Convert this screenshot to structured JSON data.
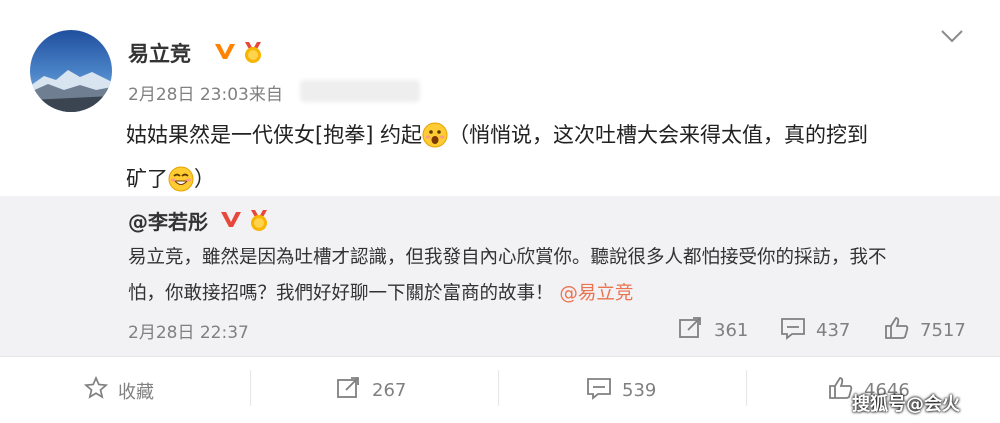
{
  "post": {
    "username": "易立竞",
    "time": "2月28日 23:03",
    "source_prefix": "来自",
    "content_part1": "姑姑果然是一代侠女[抱拳] 约起",
    "content_part2": "（悄悄说，这次吐槽大会来得太值，真的挖到",
    "content_part3": "矿了",
    "content_part4": "）"
  },
  "repost": {
    "username": "@李若彤",
    "text_line1": "易立竞，雖然是因為吐槽才認識，但我發自內心欣賞你。聽說很多人都怕接受你的採訪，我不",
    "text_line2": "怕，你敢接招嗎？我們好好聊一下關於富商的故事！",
    "mention": "@易立竞",
    "time": "2月28日 22:37",
    "reposts": "361",
    "comments": "437",
    "likes": "7517"
  },
  "actions": {
    "favorite": "收藏",
    "repost": "267",
    "comment": "539",
    "like": "4646"
  },
  "watermark": "搜狐号@会火",
  "colors": {
    "accent": "#eb7350",
    "verified": "#ff8200"
  },
  "icons": [
    "chevron-down-icon",
    "verified-v-icon",
    "medal-icon",
    "surprised-emoji",
    "grin-emoji",
    "star-icon",
    "repost-icon",
    "comment-icon",
    "like-icon"
  ]
}
